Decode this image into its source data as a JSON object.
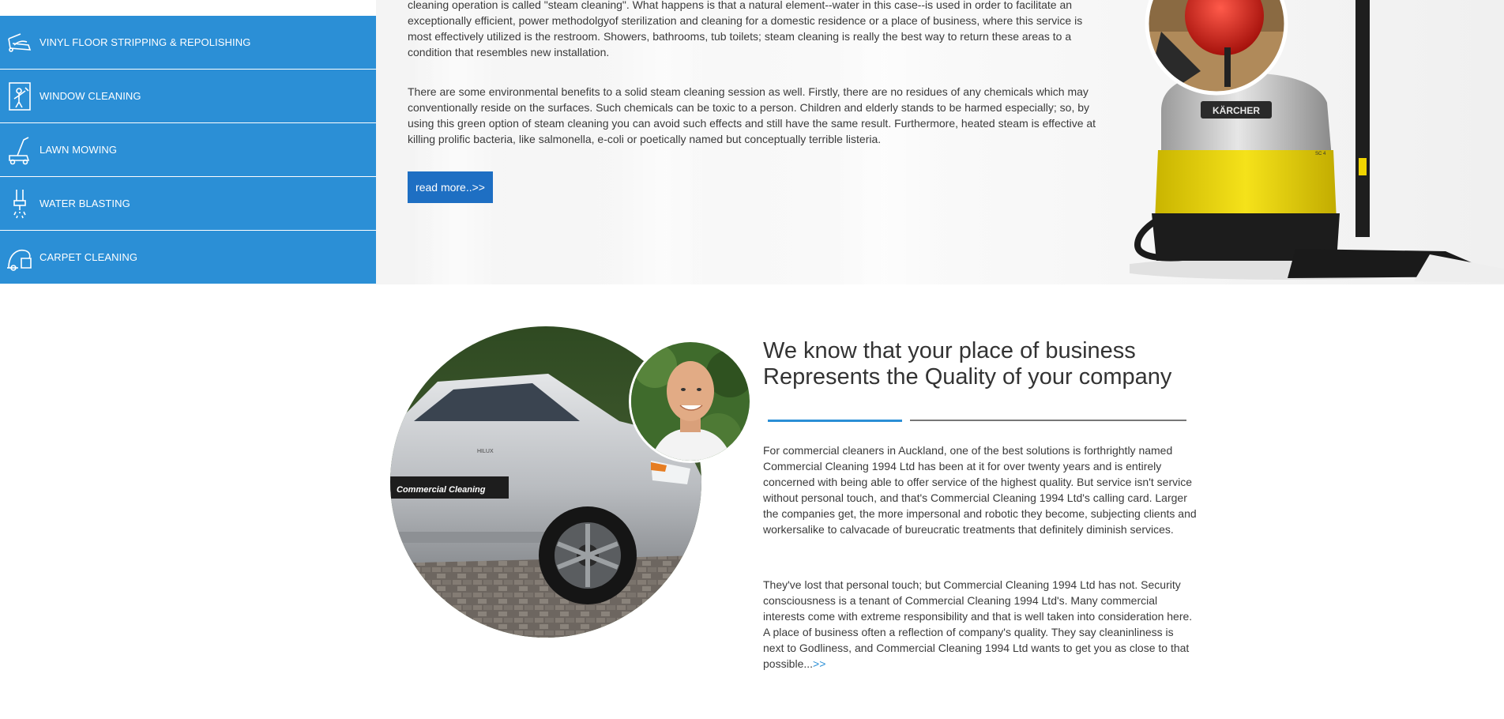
{
  "services": {
    "items": [
      {
        "label": "VINYL FLOOR STRIPPING & REPOLISHING",
        "icon": "floor-polisher-icon"
      },
      {
        "label": "WINDOW CLEANING",
        "icon": "window-cleaner-icon"
      },
      {
        "label": "LAWN MOWING",
        "icon": "lawn-mower-icon"
      },
      {
        "label": "WATER BLASTING",
        "icon": "water-blaster-icon"
      },
      {
        "label": "CARPET CLEANING",
        "icon": "vacuum-icon"
      }
    ]
  },
  "steam": {
    "para1": "cleaning operation is called \"steam cleaning\". What happens is that a natural element--water in this case--is used in order to facilitate an exceptionally efficient, power methodolgyof sterilization and cleaning for a domestic residence or a place of business, where this service is most effectively utilized is the restroom. Showers, bathrooms, tub toilets; steam cleaning is really the best way to return these areas to a condition that resembles new installation.",
    "para2": "There are some environmental benefits to a solid steam cleaning session as well. Firstly, there are no residues of any chemicals which may conventionally reside on the surfaces. Such chemicals can be toxic to a person. Children and elderly stands to be harmed especially; so, by using this green option of steam cleaning you can avoid such effects and still have the same result. Furthermore, heated steam is effective at killing prolific bacteria, like salmonella, e-coli or poetically named but conceptually terrible listeria.",
    "read_more": "read more..>>",
    "brand_logo": "KÄRCHER",
    "model_label": "SC 4"
  },
  "about": {
    "title_line1": "We know that your place of business",
    "title_line2": "Represents the Quality of your company",
    "para1": "For commercial cleaners in Auckland, one of the best solutions is forthrightly named Commercial Cleaning 1994 Ltd has been at it for over twenty years and is entirely concerned with being able to offer service of the highest quality. But service isn't service without personal touch, and that's Commercial Cleaning 1994 Ltd's calling card. Larger the companies get, the more impersonal and robotic they become, subjecting clients and workersalike to calvacade of bureucratic treatments that definitely diminish services.",
    "para2": "They've lost that personal touch; but Commercial Cleaning 1994 Ltd has not. Security consciousness is a tenant of Commercial Cleaning 1994 Ltd's. Many commercial interests come with extreme responsibility and that is well taken into consideration here. A place of business often a reflection of company's quality. They say cleaninliness is next to Godliness, and Commercial Cleaning 1994 Ltd wants to get you as close to that possible...",
    "more_link": ">>",
    "car_decal": "Commercial Cleaning",
    "car_badge": "HILUX"
  },
  "colors": {
    "accent_blue": "#2b8fd6",
    "button_blue": "#1e6fc3"
  }
}
